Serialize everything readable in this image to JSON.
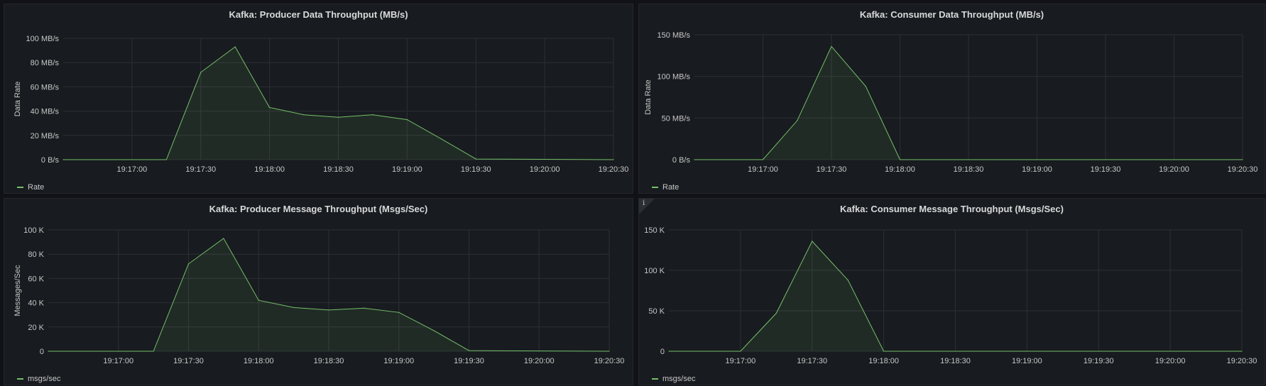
{
  "panels": [
    {
      "title": "Kafka: Producer Data Throughput (MB/s)",
      "info": false,
      "chart_data": {
        "type": "area",
        "ylabel": "Data Rate",
        "ylim": [
          0,
          100
        ],
        "yticks": [
          0,
          20,
          40,
          60,
          80,
          100
        ],
        "ytick_labels": [
          "0 B/s",
          "20 MB/s",
          "40 MB/s",
          "60 MB/s",
          "80 MB/s",
          "100 MB/s"
        ],
        "xlim": [
          "19:16:30",
          "19:20:30"
        ],
        "xtick_labels": [
          "19:17:00",
          "19:17:30",
          "19:18:00",
          "19:18:30",
          "19:19:00",
          "19:19:30",
          "19:20:00",
          "19:20:30"
        ],
        "grid": true,
        "legend": "bottom-left",
        "series": [
          {
            "name": "Rate",
            "x": [
              "19:16:30",
              "19:17:15",
              "19:17:30",
              "19:17:45",
              "19:18:00",
              "19:18:15",
              "19:18:30",
              "19:18:45",
              "19:19:00",
              "19:19:15",
              "19:19:30",
              "19:20:30"
            ],
            "values": [
              0,
              0,
              72,
              93,
              43,
              37,
              35,
              37,
              33,
              17,
              0.5,
              0
            ]
          }
        ]
      }
    },
    {
      "title": "Kafka: Consumer Data Throughput (MB/s)",
      "info": false,
      "chart_data": {
        "type": "area",
        "ylabel": "Data Rate",
        "ylim": [
          0,
          150
        ],
        "yticks": [
          0,
          50,
          100,
          150
        ],
        "ytick_labels": [
          "0 B/s",
          "50 MB/s",
          "100 MB/s",
          "150 MB/s"
        ],
        "xlim": [
          "19:16:30",
          "19:20:30"
        ],
        "xtick_labels": [
          "19:17:00",
          "19:17:30",
          "19:18:00",
          "19:18:30",
          "19:19:00",
          "19:19:30",
          "19:20:00",
          "19:20:30"
        ],
        "grid": true,
        "legend": "bottom-left",
        "series": [
          {
            "name": "Rate",
            "x": [
              "19:16:30",
              "19:17:00",
              "19:17:15",
              "19:17:30",
              "19:17:45",
              "19:18:00",
              "19:20:30"
            ],
            "values": [
              0,
              0,
              47,
              136,
              88,
              0,
              0
            ]
          }
        ]
      }
    },
    {
      "title": "Kafka: Producer Message Throughput (Msgs/Sec)",
      "info": false,
      "chart_data": {
        "type": "area",
        "ylabel": "Messages/Sec",
        "ylim": [
          0,
          100000
        ],
        "yticks": [
          0,
          20000,
          40000,
          60000,
          80000,
          100000
        ],
        "ytick_labels": [
          "0",
          "20 K",
          "40 K",
          "60 K",
          "80 K",
          "100 K"
        ],
        "xlim": [
          "19:16:30",
          "19:20:30"
        ],
        "xtick_labels": [
          "19:17:00",
          "19:17:30",
          "19:18:00",
          "19:18:30",
          "19:19:00",
          "19:19:30",
          "19:20:00",
          "19:20:30"
        ],
        "grid": true,
        "legend": "bottom-left",
        "series": [
          {
            "name": "msgs/sec",
            "x": [
              "19:16:30",
              "19:17:15",
              "19:17:30",
              "19:17:45",
              "19:18:00",
              "19:18:15",
              "19:18:30",
              "19:18:45",
              "19:19:00",
              "19:19:15",
              "19:19:30",
              "19:20:30"
            ],
            "values": [
              0,
              0,
              72000,
              93000,
              42000,
              36000,
              34000,
              35500,
              32000,
              17000,
              500,
              0
            ]
          }
        ]
      }
    },
    {
      "title": "Kafka: Consumer Message Throughput (Msgs/Sec)",
      "info": true,
      "info_glyph": "i",
      "chart_data": {
        "type": "area",
        "ylabel": "",
        "ylim": [
          0,
          150000
        ],
        "yticks": [
          0,
          50000,
          100000,
          150000
        ],
        "ytick_labels": [
          "0",
          "50 K",
          "100 K",
          "150 K"
        ],
        "xlim": [
          "19:16:30",
          "19:20:30"
        ],
        "xtick_labels": [
          "19:17:00",
          "19:17:30",
          "19:18:00",
          "19:18:30",
          "19:19:00",
          "19:19:30",
          "19:20:00",
          "19:20:30"
        ],
        "grid": true,
        "legend": "bottom-left",
        "series": [
          {
            "name": "msgs/sec",
            "x": [
              "19:16:30",
              "19:17:00",
              "19:17:15",
              "19:17:30",
              "19:17:45",
              "19:18:00",
              "19:20:30"
            ],
            "values": [
              0,
              0,
              47000,
              136000,
              88000,
              0,
              0
            ]
          }
        ]
      }
    }
  ],
  "colors": {
    "background": "#111217",
    "panel": "#181b1f",
    "grid": "#2c2f34",
    "series_line": "#73bf69",
    "series_fill": "rgba(115,191,105,0.10)",
    "text": "#c7c7c7"
  }
}
